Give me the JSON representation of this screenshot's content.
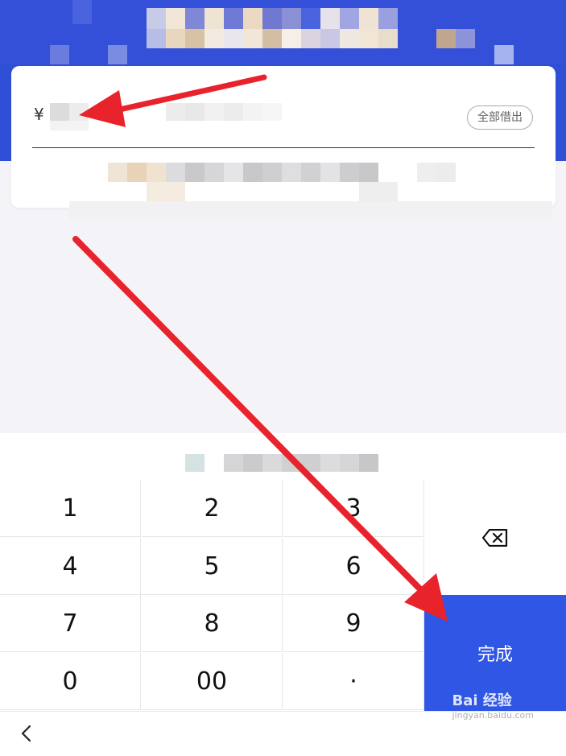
{
  "card": {
    "currency_symbol": "¥",
    "borrow_all_label": "全部借出"
  },
  "keypad": {
    "keys": [
      "1",
      "2",
      "3",
      "4",
      "5",
      "6",
      "7",
      "8",
      "9",
      "0",
      "00",
      "·"
    ],
    "done_label": "完成"
  },
  "icons": {
    "delete": "backspace-icon",
    "back": "chevron-left-icon"
  },
  "watermark": {
    "brand": "Bai 经验",
    "url": "jingyan.baidu.com"
  },
  "colors": {
    "accent": "#2f56e4",
    "banner": "#2f4fd6",
    "annotation": "#e8232b"
  }
}
